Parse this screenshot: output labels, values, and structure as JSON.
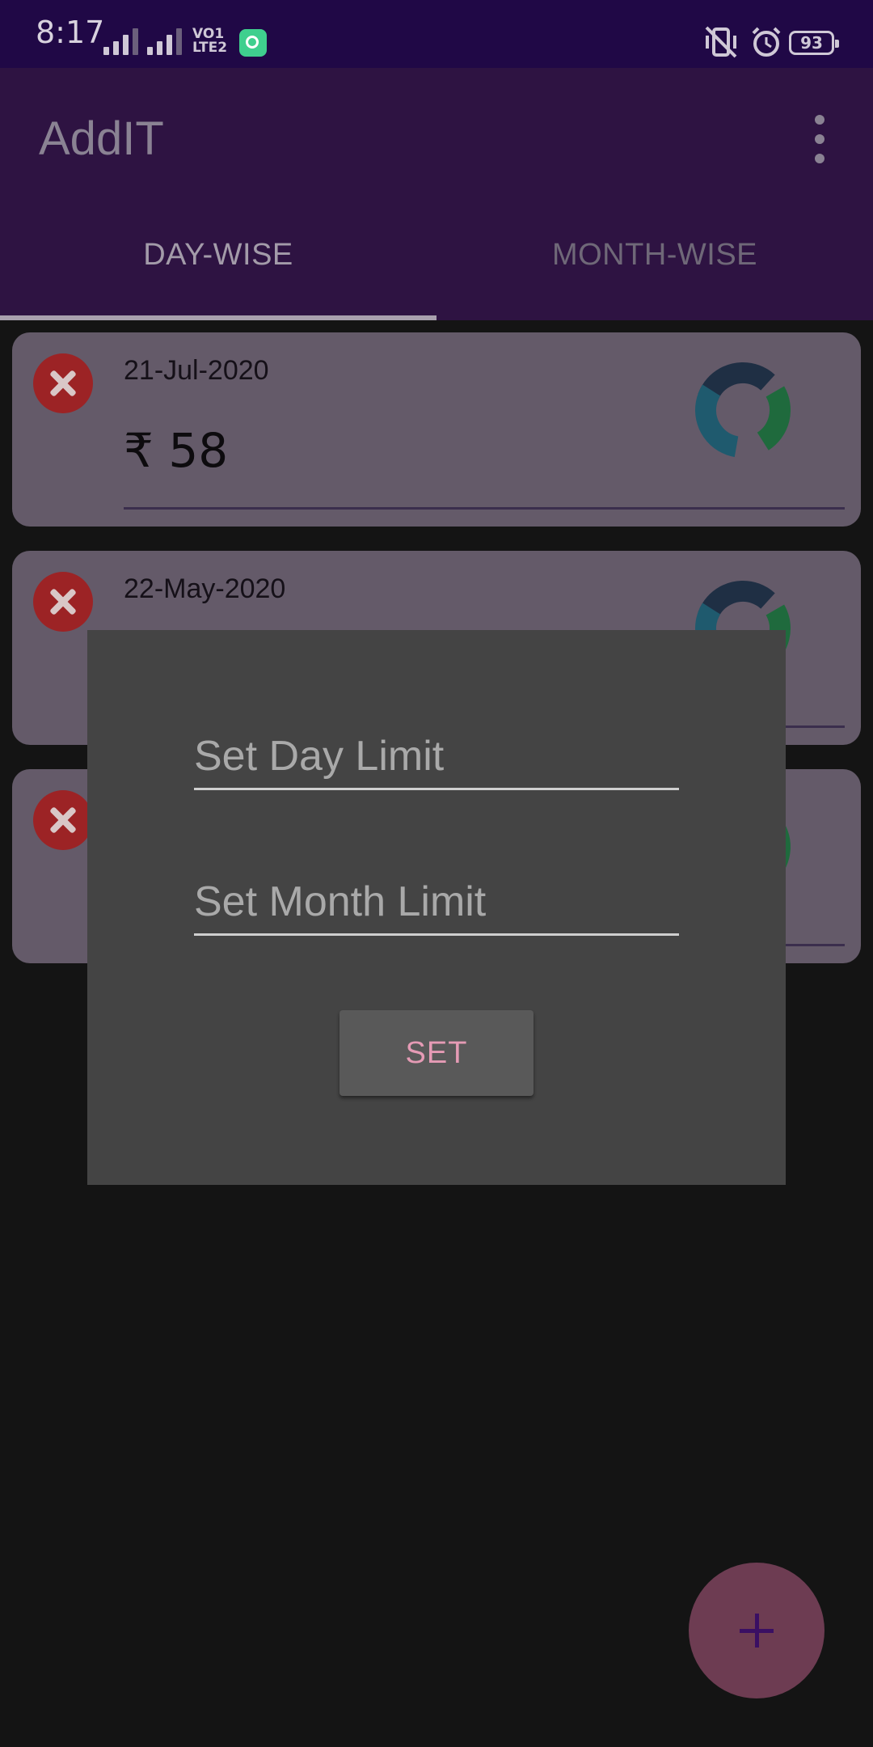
{
  "status_bar": {
    "time": "8:17",
    "network_label_1": "VO",
    "network_label_2": "LTE",
    "sim_1": "1",
    "sim_2": "2",
    "battery": "93"
  },
  "app_bar": {
    "title": "AddIT",
    "tabs": [
      {
        "label": "DAY-WISE",
        "selected": true
      },
      {
        "label": "MONTH-WISE",
        "selected": false
      }
    ]
  },
  "entries": [
    {
      "date": "21-Jul-2020",
      "amount": "₹ 58"
    },
    {
      "date": "22-May-2020",
      "amount": ""
    },
    {
      "date": "",
      "amount": ""
    }
  ],
  "dialog": {
    "day_limit_placeholder": "Set Day Limit",
    "month_limit_placeholder": "Set Month Limit",
    "set_label": "SET"
  },
  "colors": {
    "status_bar": "#200846",
    "app_bar": "#2e1342",
    "card": "#645a69",
    "dialog": "#444444",
    "accent": "#e59bb5"
  }
}
